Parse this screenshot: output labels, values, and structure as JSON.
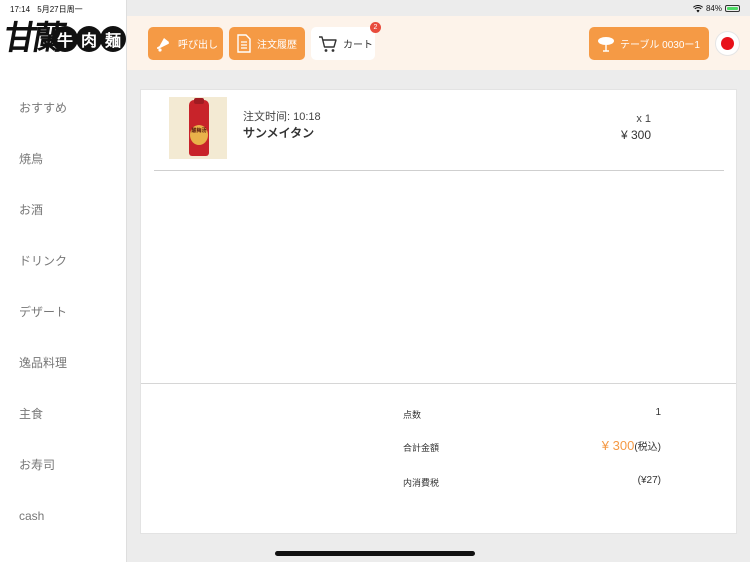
{
  "status_bar": {
    "time": "17:14",
    "date": "5月27日周一",
    "battery": "84%"
  },
  "logo": {
    "main": "甘蘭",
    "circles": [
      "牛",
      "肉",
      "麺"
    ]
  },
  "categories": [
    "おすすめ",
    "焼鳥",
    "お酒",
    "ドリンク",
    "デザート",
    "逸品料理",
    "主食",
    "お寿司",
    "cash"
  ],
  "header": {
    "call_label": "呼び出し",
    "history_label": "注文履歴",
    "cart_label": "カート",
    "cart_badge": "2",
    "table_label": "テーブル 0030ー1"
  },
  "order": {
    "time_label": "注文时间: 10:18",
    "item_name": "サンメイタン",
    "qty": "x 1",
    "price": "¥ 300",
    "image_text": "酸梅汤"
  },
  "summary": {
    "count_label": "点数",
    "count_value": "1",
    "total_label": "合計金額",
    "total_value": "¥ 300",
    "total_suffix": "(税込)",
    "tax_label": "内消費税",
    "tax_value": "(¥27)"
  },
  "colors": {
    "accent": "#f59a45",
    "header_bg": "#fdf3ea",
    "badge": "#e84c3d",
    "record": "#e8111a"
  }
}
